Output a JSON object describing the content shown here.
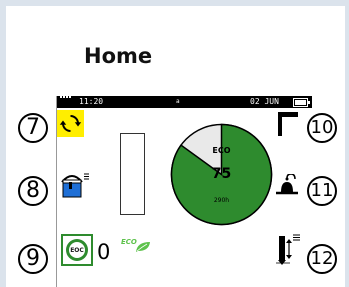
{
  "page": {
    "title": "Home"
  },
  "status_bar": {
    "time": "11:20",
    "center_mark": "a",
    "date": "02 JUN"
  },
  "callouts": {
    "n7": "7",
    "n8": "8",
    "n9": "9",
    "n10": "10",
    "n11": "11",
    "n12": "12"
  },
  "gauge": {
    "label": "ECO",
    "value": "75",
    "hours": "290h",
    "fill_fraction": 0.85,
    "fill_color": "#2e8b2e",
    "remainder_color": "#e9e9e9"
  },
  "counter": {
    "eoc_label": "EOC",
    "value": "0",
    "eco_badge": "ECO"
  },
  "icons": {
    "left": [
      "cycle-arrows-icon",
      "container-fill-icon",
      "eoc-icon",
      "eco-leaf-icon"
    ],
    "right": [
      "flag-icon",
      "bell-sensor-icon",
      "vertical-adjust-icon"
    ]
  },
  "colors": {
    "accent_yellow": "#ffee00",
    "blue": "#1f6fd6",
    "green": "#2e8b2e",
    "light_green": "#5ec24c"
  }
}
